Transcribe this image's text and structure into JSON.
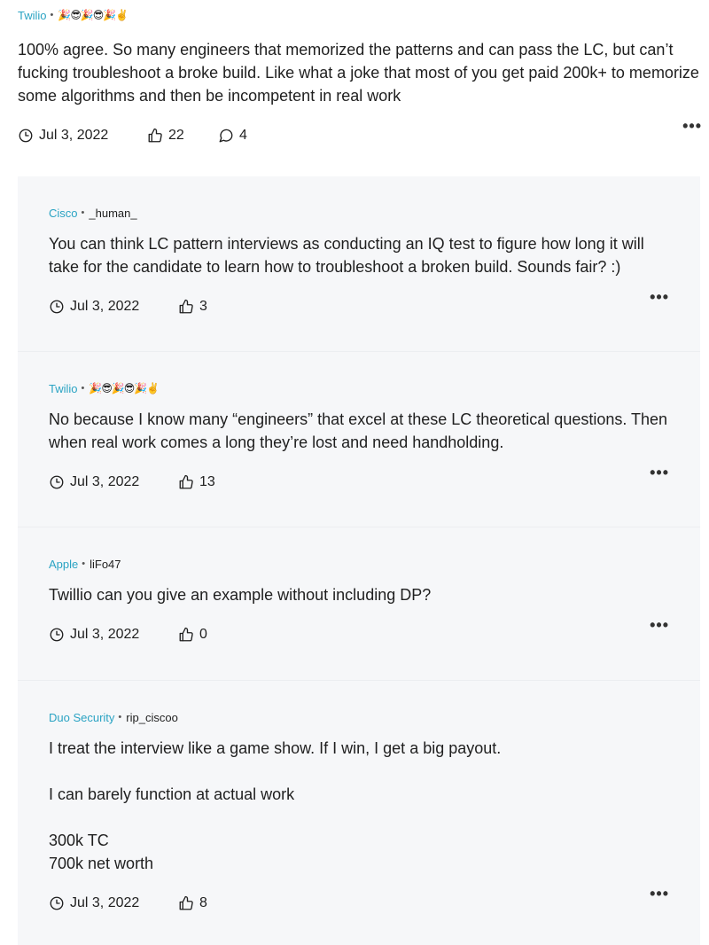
{
  "main_post": {
    "company": "Twilio",
    "username": "🎉😎🎉😎🎉✌️",
    "text": "100% agree. So many engineers that memorized the patterns and can pass the LC, but can’t fucking troubleshoot a broke build. Like what a joke that most of you get paid 200k+ to memorize some algorithms and then be incompetent in real work",
    "date": "Jul 3, 2022",
    "likes": "22",
    "comments": "4"
  },
  "replies": [
    {
      "company": "Cisco",
      "username": "_human_",
      "text": "You can think LC pattern interviews as conducting an IQ test to figure how long it will take for the candidate to learn how to troubleshoot a broken build. Sounds fair? :)",
      "date": "Jul 3, 2022",
      "likes": "3"
    },
    {
      "company": "Twilio",
      "username": "🎉😎🎉😎🎉✌️",
      "text": "No because I know many “engineers” that excel at these LC theoretical questions. Then when real work comes a long they’re lost and need handholding.",
      "date": "Jul 3, 2022",
      "likes": "13"
    },
    {
      "company": "Apple",
      "username": "liFo47",
      "text": "Twillio can you give an example without including DP?",
      "date": "Jul 3, 2022",
      "likes": "0"
    },
    {
      "company": "Duo Security",
      "username": "rip_ciscoo",
      "text": "I treat the interview like a game show. If I win, I get a big payout.\n\nI can barely function at actual work\n\n300k TC\n700k net worth",
      "date": "Jul 3, 2022",
      "likes": "8"
    }
  ],
  "icons": {
    "date": "clock-icon",
    "likes": "thumbs-up-icon",
    "comments": "comment-icon",
    "more": "more-options-icon"
  },
  "more_label": "•••",
  "colors": {
    "company": "#2aa3c3",
    "reply_background": "#f6f7f9"
  }
}
